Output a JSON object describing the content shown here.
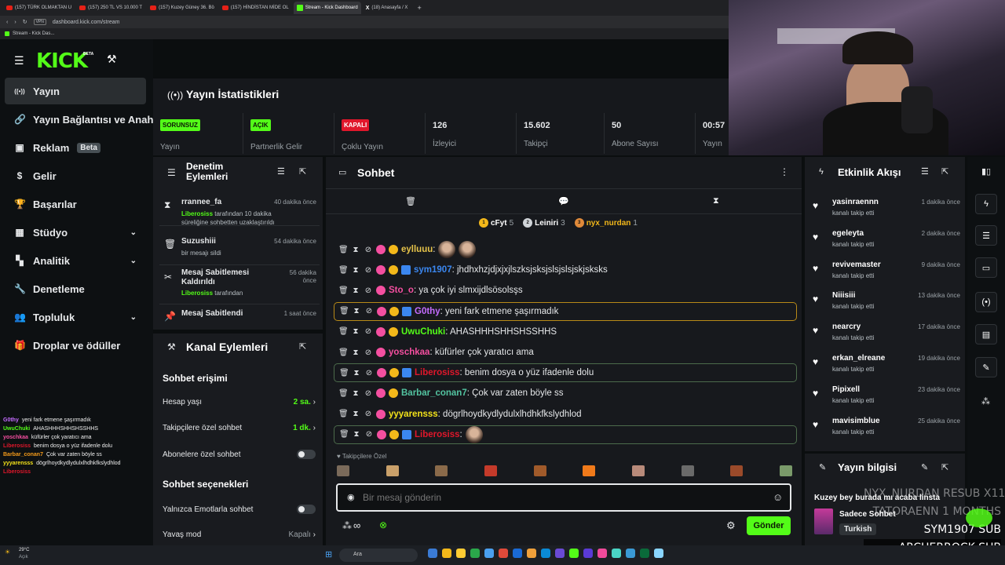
{
  "browser": {
    "tabs": [
      {
        "label": "(157) TÜRK OLMAKTAN U",
        "icon": "youtube-icon",
        "active": false
      },
      {
        "label": "(157) 250 TL VS 10.000 T",
        "icon": "youtube-icon",
        "active": false
      },
      {
        "label": "(157) Kuzey Güney 36. Bö",
        "icon": "youtube-icon",
        "active": false
      },
      {
        "label": "(157) HİNDİSTAN MİDE OL",
        "icon": "youtube-icon",
        "active": false
      },
      {
        "label": "Stream - Kick Dashboard",
        "icon": "kick-icon",
        "active": true
      },
      {
        "label": "(18) Anasayfa / X",
        "icon": "x-icon",
        "active": false
      }
    ],
    "url": "dashboard.kick.com/stream",
    "vpn": "VPN",
    "bookmark": "Stream - Kick Das..."
  },
  "logo": {
    "text": "KICK",
    "tag": "BETA"
  },
  "nav": {
    "items": [
      {
        "label": "Yayın",
        "icon": "broadcast-icon",
        "selected": true
      },
      {
        "label": "Yayın Bağlantısı ve Anahtar",
        "icon": "link-icon"
      },
      {
        "label": "Reklam",
        "icon": "ad-icon",
        "badge": "Beta"
      },
      {
        "label": "Gelir",
        "icon": "dollar-icon"
      },
      {
        "label": "Başarılar",
        "icon": "trophy-icon"
      },
      {
        "label": "Stüdyo",
        "icon": "studio-icon",
        "chevron": true
      },
      {
        "label": "Analitik",
        "icon": "analytics-icon",
        "chevron": true
      },
      {
        "label": "Denetleme",
        "icon": "wrench-icon"
      },
      {
        "label": "Topluluk",
        "icon": "community-icon",
        "chevron": true
      },
      {
        "label": "Droplar ve ödüller",
        "icon": "gift-icon"
      }
    ]
  },
  "stats": {
    "title": "Yayın İstatistikleri",
    "cells": [
      {
        "pill": "SORUNSUZ",
        "label": "Yayın"
      },
      {
        "pill": "AÇIK",
        "label": "Partnerlik Gelir"
      },
      {
        "pill": "KAPALI",
        "label": "Çoklu Yayın"
      },
      {
        "value": "126",
        "label": "İzleyici"
      },
      {
        "value": "15.602",
        "label": "Takipçi"
      },
      {
        "value": "50",
        "label": "Abone Sayısı"
      },
      {
        "value": "00:57",
        "label": "Yayın"
      }
    ]
  },
  "moderation": {
    "title": "Denetim Eylemleri",
    "items": [
      {
        "name": "rrannee_fa",
        "time": "40 dakika önce",
        "actor": "Liberosiss",
        "desc": " tarafından 10 dakika süreliğine sohbetten uzaklaştırıldı"
      },
      {
        "name": "Suzushiii",
        "time": "54 dakika önce",
        "desc": "bir mesajı sildi"
      },
      {
        "name": "Mesaj Sabitlemesi Kaldırıldı",
        "time": "56 dakika önce",
        "actor": "Liberosiss",
        "desc": " tarafından"
      },
      {
        "name": "Mesaj Sabitlendi",
        "time": "1 saat önce"
      }
    ]
  },
  "channel": {
    "title": "Kanal Eylemleri",
    "chat_access": "Sohbet erişimi",
    "account_age_label": "Hesap yaşı",
    "account_age_value": "2 sa.",
    "followers_label": "Takipçilere özel sohbet",
    "followers_value": "1 dk.",
    "subs_label": "Abonelere özel sohbet",
    "options": "Sohbet seçenekleri",
    "emote_label": "Yalnızca Emotlarla sohbet",
    "slow_label": "Yavaş mod",
    "slow_value": "Kapalı"
  },
  "chat": {
    "title": "Sohbet",
    "leaders": [
      {
        "rank": "1",
        "name": "cFyt",
        "count": "5"
      },
      {
        "rank": "2",
        "name": "Leiniri",
        "count": "3"
      },
      {
        "rank": "3",
        "name": "nyx_nurdan",
        "count": "1"
      }
    ],
    "messages": [
      {
        "user": "eylluuu",
        "color": "#e6c34a",
        "text": ":",
        "emotes": 2
      },
      {
        "user": "sym1907",
        "color": "#3b87f0",
        "text": ": jhdhxhzjdjxjxjlszksjsksjslsjslsjskjsksks"
      },
      {
        "user": "Sto_o",
        "color": "#f44fa0",
        "text": ": ya çok iyi slmxijdlsösolsşs"
      },
      {
        "user": "G0thy",
        "color": "#c46cff",
        "text": ": yeni fark etmene şaşırmadık",
        "hl": "yellow"
      },
      {
        "user": "UwuChuki",
        "color": "#53fc18",
        "text": ": AHASHHHSHHSHSSHHS"
      },
      {
        "user": "yoschkaa",
        "color": "#f44fa0",
        "text": ": küfürler çok yaratıcı ama"
      },
      {
        "user": "Liberosiss",
        "color": "#e0172b",
        "text": ": benim dosya o yüz ifadenle dolu",
        "hl": "green"
      },
      {
        "user": "Barbar_conan7",
        "color": "#53c3a0",
        "text": ": Çok var zaten böyle ss"
      },
      {
        "user": "yyyarensss",
        "color": "#f3e21a",
        "text": ": dögrlhoydkydlydulxlhdhkfkslydhlod"
      },
      {
        "user": "Liberosiss",
        "color": "#e0172b",
        "text": ":",
        "emotes": 1,
        "hl": "green"
      }
    ],
    "followers_only": "Takipçilere Özel",
    "input_placeholder": "Bir mesaj gönderin",
    "send_label": "Gönder"
  },
  "events": {
    "title": "Etkinlik Akışı",
    "items": [
      {
        "name": "yasinraennn",
        "sub": "kanalı takip etti",
        "time": "1 dakika önce"
      },
      {
        "name": "egeleyta",
        "sub": "kanalı takip etti",
        "time": "2 dakika önce"
      },
      {
        "name": "revivemaster",
        "sub": "kanalı takip etti",
        "time": "9 dakika önce"
      },
      {
        "name": "Niiisiii",
        "sub": "kanalı takip etti",
        "time": "13 dakika önce"
      },
      {
        "name": "nearcry",
        "sub": "kanalı takip etti",
        "time": "17 dakika önce"
      },
      {
        "name": "erkan_elreane",
        "sub": "kanalı takip etti",
        "time": "19 dakika önce"
      },
      {
        "name": "Pipixell",
        "sub": "kanalı takip etti",
        "time": "23 dakika önce"
      },
      {
        "name": "mavisimblue",
        "sub": "kanalı takip etti",
        "time": "25 dakika önce"
      }
    ]
  },
  "info": {
    "title": "Yayın bilgisi",
    "stream_title": "Kuzey bey burada mı acaba linsta",
    "category": "Sadece Sohbet",
    "language": "Turkish"
  },
  "overlay": {
    "sub_lines": [
      "NYX_NURDAN RESUB X11",
      "TATORAENN 1 MONTHS",
      "SYM1907 SUB",
      "ARCHERROCK SUB"
    ],
    "chat": [
      {
        "user": "G0thy",
        "color": "#c46cff",
        "text": "yeni fark etmene şaşırmadık"
      },
      {
        "user": "UwuChuki",
        "color": "#53fc18",
        "text": "AHASHHHSHHSHSSHHS"
      },
      {
        "user": "yoschkaa",
        "color": "#f44fa0",
        "text": "küfürler çok yaratıcı ama"
      },
      {
        "user": "Liberosiss",
        "color": "#e0172b",
        "text": "benim dosya o yüz ifadenle dolu"
      },
      {
        "user": "Barbar_conan7",
        "color": "#f39a1a",
        "text": "Çok var zaten böyle ss"
      },
      {
        "user": "yyyarensss",
        "color": "#f3e21a",
        "text": "dögrlhoydkydlydulxlhdhkfkslydhlod"
      },
      {
        "user": "Liberosiss",
        "color": "#e0172b",
        "text": ""
      }
    ]
  },
  "taskbar": {
    "weather_temp": "29°C",
    "weather_desc": "Açık",
    "search": "Ara"
  },
  "colors": {
    "accent": "#53fc18",
    "danger": "#e0172b"
  }
}
